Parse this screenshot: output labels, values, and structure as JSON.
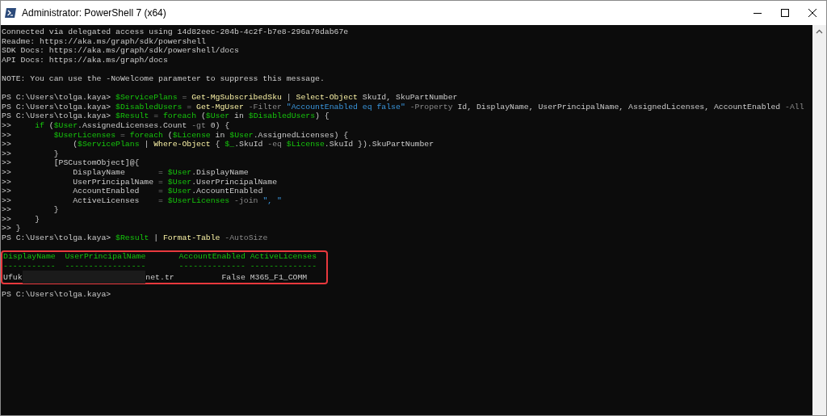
{
  "window": {
    "title": "Administrator: PowerShell 7 (x64)"
  },
  "console": {
    "blocks": [
      {
        "kind": "line",
        "segments": [
          {
            "text": "Connected via delegated access using 14d82eec-204b-4c2f-b7e8-296a70dab67e",
            "kind": "text"
          }
        ]
      },
      {
        "kind": "line",
        "segments": [
          {
            "text": "Readme: https://aka.ms/graph/sdk/powershell",
            "kind": "text"
          }
        ]
      },
      {
        "kind": "line",
        "segments": [
          {
            "text": "SDK Docs: https://aka.ms/graph/sdk/powershell/docs",
            "kind": "text"
          }
        ]
      },
      {
        "kind": "line",
        "segments": [
          {
            "text": "API Docs: https://aka.ms/graph/docs",
            "kind": "text"
          }
        ]
      },
      {
        "kind": "blank"
      },
      {
        "kind": "line",
        "segments": [
          {
            "text": "NOTE: You can use the -NoWelcome parameter to suppress this message.",
            "kind": "text"
          }
        ]
      },
      {
        "kind": "blank"
      },
      {
        "kind": "line",
        "segments": [
          {
            "text": "PS C:\\Users\\tolga.kaya> ",
            "kind": "text"
          },
          {
            "text": "$ServicePlans",
            "kind": "variable"
          },
          {
            "text": " = ",
            "kind": "operator"
          },
          {
            "text": "Get-MgSubscribedSku",
            "kind": "command"
          },
          {
            "text": " | ",
            "kind": "text"
          },
          {
            "text": "Select-Object",
            "kind": "command"
          },
          {
            "text": " SkuId, SkuPartNumber",
            "kind": "text"
          }
        ]
      },
      {
        "kind": "line",
        "segments": [
          {
            "text": "PS C:\\Users\\tolga.kaya> ",
            "kind": "text"
          },
          {
            "text": "$DisabledUsers",
            "kind": "variable"
          },
          {
            "text": " = ",
            "kind": "operator"
          },
          {
            "text": "Get-MgUser",
            "kind": "command"
          },
          {
            "text": " -Filter ",
            "kind": "parameter"
          },
          {
            "text": "\"AccountEnabled eq false\" ",
            "kind": "string"
          },
          {
            "text": "-Property",
            "kind": "parameter"
          },
          {
            "text": " Id, DisplayName, UserPrincipalName, AssignedLicenses, AccountEnabled ",
            "kind": "text"
          },
          {
            "text": "-All",
            "kind": "parameter"
          }
        ]
      },
      {
        "kind": "line",
        "segments": [
          {
            "text": "PS C:\\Users\\tolga.kaya> ",
            "kind": "text"
          },
          {
            "text": "$Result",
            "kind": "variable"
          },
          {
            "text": " = ",
            "kind": "operator"
          },
          {
            "text": "foreach",
            "kind": "keyword"
          },
          {
            "text": " (",
            "kind": "text"
          },
          {
            "text": "$User",
            "kind": "variable"
          },
          {
            "text": " in ",
            "kind": "text"
          },
          {
            "text": "$DisabledUsers",
            "kind": "variable"
          },
          {
            "text": ") {",
            "kind": "text"
          }
        ]
      },
      {
        "kind": "line",
        "segments": [
          {
            "text": ">>     ",
            "kind": "text"
          },
          {
            "text": "if",
            "kind": "keyword"
          },
          {
            "text": " (",
            "kind": "text"
          },
          {
            "text": "$User",
            "kind": "variable"
          },
          {
            "text": ".AssignedLicenses.Count ",
            "kind": "text"
          },
          {
            "text": "-gt",
            "kind": "parameter"
          },
          {
            "text": " 0) {",
            "kind": "text"
          }
        ]
      },
      {
        "kind": "line",
        "segments": [
          {
            "text": ">>         ",
            "kind": "text"
          },
          {
            "text": "$UserLicenses",
            "kind": "variable"
          },
          {
            "text": " = ",
            "kind": "operator"
          },
          {
            "text": "foreach",
            "kind": "keyword"
          },
          {
            "text": " (",
            "kind": "text"
          },
          {
            "text": "$License",
            "kind": "variable"
          },
          {
            "text": " in ",
            "kind": "text"
          },
          {
            "text": "$User",
            "kind": "variable"
          },
          {
            "text": ".AssignedLicenses) {",
            "kind": "text"
          }
        ]
      },
      {
        "kind": "line",
        "segments": [
          {
            "text": ">>             (",
            "kind": "text"
          },
          {
            "text": "$ServicePlans",
            "kind": "variable"
          },
          {
            "text": " | ",
            "kind": "text"
          },
          {
            "text": "Where-Object",
            "kind": "command"
          },
          {
            "text": " { ",
            "kind": "text"
          },
          {
            "text": "$_",
            "kind": "variable"
          },
          {
            "text": ".SkuId ",
            "kind": "text"
          },
          {
            "text": "-eq ",
            "kind": "parameter"
          },
          {
            "text": "$License",
            "kind": "variable"
          },
          {
            "text": ".SkuId }).SkuPartNumber",
            "kind": "text"
          }
        ]
      },
      {
        "kind": "line",
        "segments": [
          {
            "text": ">>         }",
            "kind": "text"
          }
        ]
      },
      {
        "kind": "line",
        "segments": [
          {
            "text": ">>         [PSCustomObject]@{",
            "kind": "text"
          }
        ]
      },
      {
        "kind": "line",
        "segments": [
          {
            "text": ">>             DisplayName       ",
            "kind": "text"
          },
          {
            "text": "= ",
            "kind": "operator"
          },
          {
            "text": "$User",
            "kind": "variable"
          },
          {
            "text": ".DisplayName",
            "kind": "text"
          }
        ]
      },
      {
        "kind": "line",
        "segments": [
          {
            "text": ">>             UserPrincipalName ",
            "kind": "text"
          },
          {
            "text": "= ",
            "kind": "operator"
          },
          {
            "text": "$User",
            "kind": "variable"
          },
          {
            "text": ".UserPrincipalName",
            "kind": "text"
          }
        ]
      },
      {
        "kind": "line",
        "segments": [
          {
            "text": ">>             AccountEnabled    ",
            "kind": "text"
          },
          {
            "text": "= ",
            "kind": "operator"
          },
          {
            "text": "$User",
            "kind": "variable"
          },
          {
            "text": ".AccountEnabled",
            "kind": "text"
          }
        ]
      },
      {
        "kind": "line",
        "segments": [
          {
            "text": ">>             ActiveLicenses    ",
            "kind": "text"
          },
          {
            "text": "= ",
            "kind": "operator"
          },
          {
            "text": "$UserLicenses",
            "kind": "variable"
          },
          {
            "text": " -join ",
            "kind": "parameter"
          },
          {
            "text": "\", \"",
            "kind": "string"
          }
        ]
      },
      {
        "kind": "line",
        "segments": [
          {
            "text": ">>         }",
            "kind": "text"
          }
        ]
      },
      {
        "kind": "line",
        "segments": [
          {
            "text": ">>     }",
            "kind": "text"
          }
        ]
      },
      {
        "kind": "line",
        "segments": [
          {
            "text": ">> }",
            "kind": "text"
          }
        ]
      },
      {
        "kind": "line",
        "segments": [
          {
            "text": "PS C:\\Users\\tolga.kaya> ",
            "kind": "text"
          },
          {
            "text": "$Result",
            "kind": "variable"
          },
          {
            "text": " | ",
            "kind": "text"
          },
          {
            "text": "Format-Table",
            "kind": "command"
          },
          {
            "text": " -AutoSize",
            "kind": "parameter"
          }
        ]
      },
      {
        "kind": "blank"
      },
      {
        "kind": "highlight",
        "table": {
          "header": "DisplayName  UserPrincipalName       AccountEnabled ActiveLicenses",
          "rule": "-----------  -----------------       -------------- --------------",
          "rows": [
            {
              "cells": [
                {
                  "kind": "text",
                  "text": "Ufuk"
                },
                {
                  "kind": "redacted"
                },
                {
                  "kind": "text",
                  "text": "net.tr"
                },
                {
                  "kind": "text",
                  "text": "False"
                },
                {
                  "kind": "text",
                  "text": "M365_F1_COMM"
                }
              ]
            }
          ]
        }
      },
      {
        "kind": "blank"
      },
      {
        "kind": "line",
        "segments": [
          {
            "text": "PS C:\\Users\\tolga.kaya>",
            "kind": "text"
          }
        ]
      }
    ]
  }
}
